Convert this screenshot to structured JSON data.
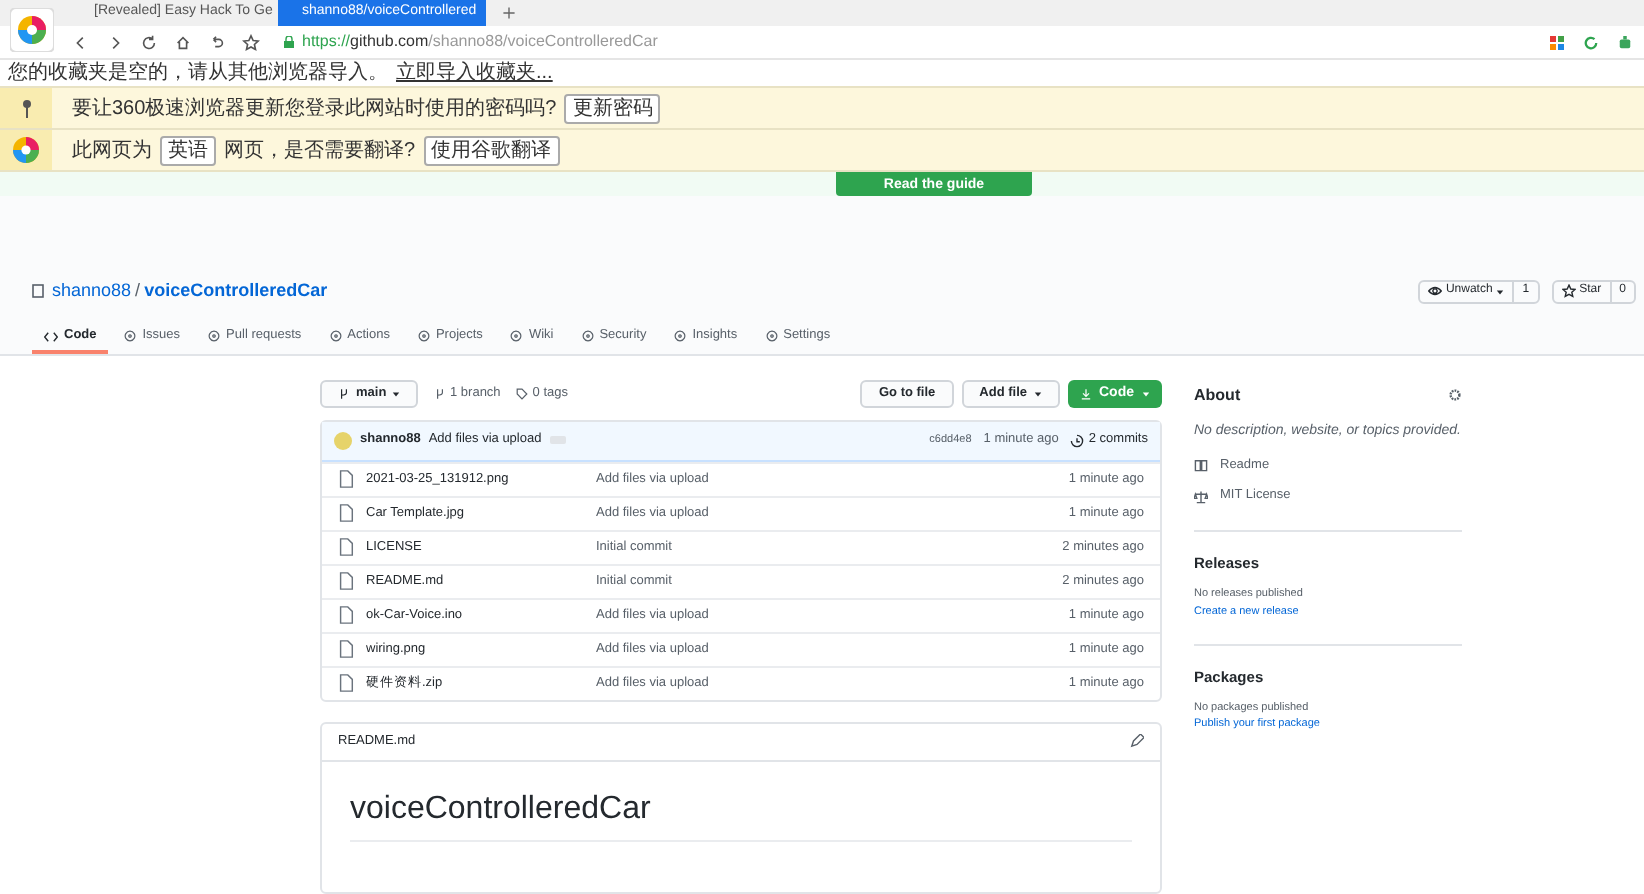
{
  "browser": {
    "tabs": [
      {
        "title": "[Revealed] Easy Hack To Ge",
        "selected": false
      },
      {
        "title": "shanno88/voiceControllered",
        "selected": true
      }
    ],
    "url": {
      "scheme": "https://",
      "host": "github.com",
      "path": "/shanno88/voiceControlleredCar"
    },
    "bookmark_bar": {
      "text": "您的收藏夹是空的，请从其他浏览器导入。",
      "link": "立即导入收藏夹..."
    },
    "infobars": [
      {
        "kind": "password",
        "text": "要让360极速浏览器更新您登录此网站时使用的密码吗?",
        "button": "更新密码"
      },
      {
        "kind": "translate",
        "text_before": "此网页为",
        "language": "英语",
        "text_after": "网页，是否需要翻译?",
        "button": "使用谷歌翻译"
      }
    ]
  },
  "page": {
    "guide_button": "Read the guide",
    "repo": {
      "owner": "shanno88",
      "separator": "/",
      "name": "voiceControlleredCar",
      "watch": "Unwatch",
      "watch_count": "1",
      "star": "Star",
      "star_count": "0"
    },
    "nav": [
      {
        "label": "Code",
        "selected": true
      },
      {
        "label": "Issues",
        "selected": false
      },
      {
        "label": "Pull requests",
        "selected": false
      },
      {
        "label": "Actions",
        "selected": false
      },
      {
        "label": "Projects",
        "selected": false
      },
      {
        "label": "Wiki",
        "selected": false
      },
      {
        "label": "Security",
        "selected": false
      },
      {
        "label": "Insights",
        "selected": false
      },
      {
        "label": "Settings",
        "selected": false
      }
    ],
    "branch": "main",
    "branches": "1 branch",
    "tags": "0 tags",
    "buttons": [
      "Go to file",
      "Add file",
      "Code"
    ],
    "commit": {
      "author": "shanno88",
      "message": "Add files via upload",
      "hash": "c6dd4e8",
      "time": "1 minute ago",
      "count": "2 commits"
    },
    "files": [
      {
        "name": "2021-03-25_131912.png",
        "message": "Add files via upload",
        "time": "1 minute ago"
      },
      {
        "name": "Car Template.jpg",
        "message": "Add files via upload",
        "time": "1 minute ago"
      },
      {
        "name": "LICENSE",
        "message": "Initial commit",
        "time": "2 minutes ago"
      },
      {
        "name": "README.md",
        "message": "Initial commit",
        "time": "2 minutes ago"
      },
      {
        "name": "ok-Car-Voice.ino",
        "message": "Add files via upload",
        "time": "1 minute ago"
      },
      {
        "name": "wiring.png",
        "message": "Add files via upload",
        "time": "1 minute ago"
      },
      {
        "name": "硬件资料.zip",
        "message": "Add files via upload",
        "time": "1 minute ago"
      }
    ],
    "readme": {
      "file": "README.md",
      "heading": "voiceControlleredCar"
    },
    "about": {
      "title": "About",
      "description": "No description, website, or topics provided.",
      "links": [
        "Readme",
        "MIT License"
      ]
    },
    "releases": {
      "title": "Releases",
      "text": "No releases published",
      "link": "Create a new release"
    },
    "packages": {
      "title": "Packages",
      "text": "No packages published",
      "link": "Publish your first package"
    }
  }
}
